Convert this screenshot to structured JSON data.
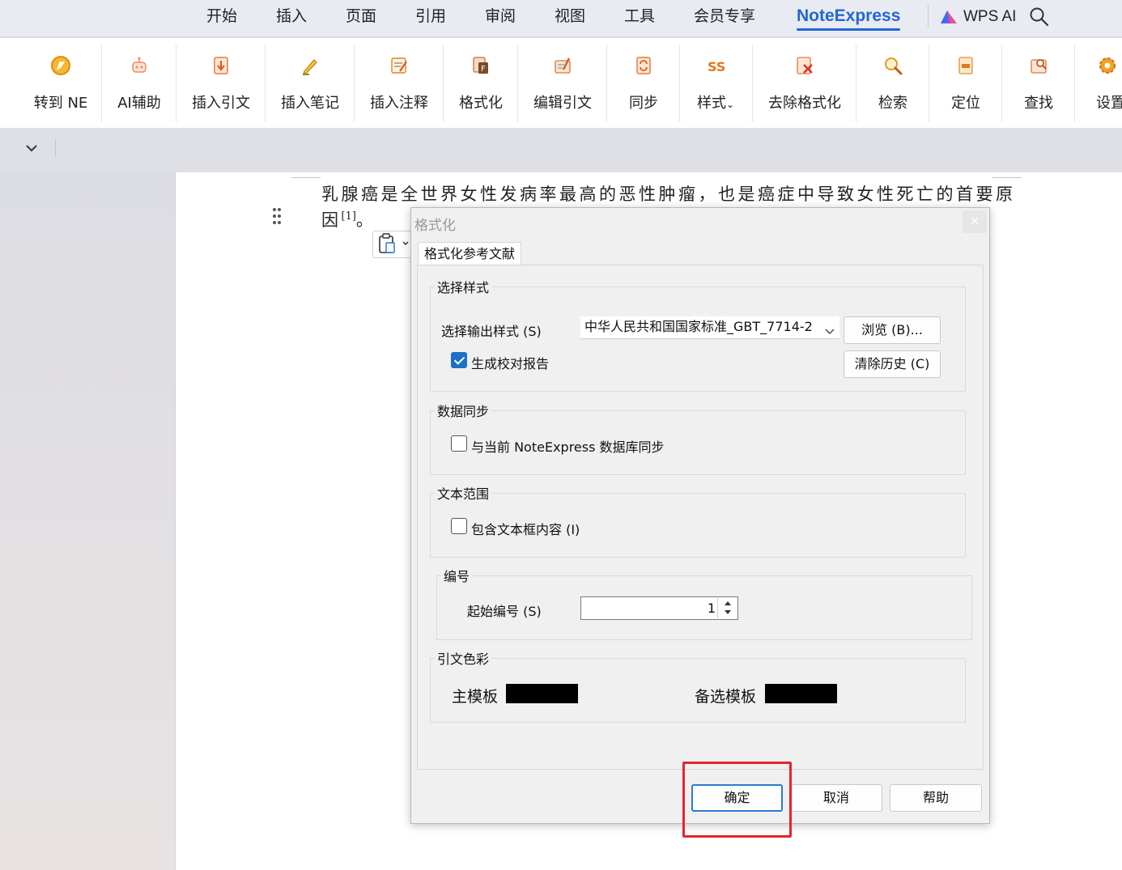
{
  "menu": {
    "items": [
      "开始",
      "插入",
      "页面",
      "引用",
      "审阅",
      "视图",
      "工具",
      "会员专享",
      "NoteExpress"
    ],
    "active_index": 8,
    "wps_ai": "WPS AI"
  },
  "ribbon": {
    "buttons": [
      "转到 NE",
      "AI辅助",
      "插入引文",
      "插入笔记",
      "插入注释",
      "格式化",
      "编辑引文",
      "同步",
      "样式",
      "去除格式化",
      "检索",
      "定位",
      "查找",
      "设置"
    ]
  },
  "document": {
    "line1": "乳腺癌是全世界女性发病率最高的恶性肿瘤，也是癌症中导致女性死亡的首要原",
    "line2": "因",
    "citation": "[1]",
    "line2_end": "。"
  },
  "dialog": {
    "title": "格式化",
    "tab": "格式化参考文献",
    "style_group": {
      "legend": "选择样式",
      "output_label": "选择输出样式 (S)",
      "selected_style": "中华人民共和国国家标准_GBT_7714-2",
      "browse_button": "浏览 (B)...",
      "clear_history_button": "清除历史 (C)",
      "report_checkbox": "生成校对报告",
      "report_checked": true
    },
    "sync_group": {
      "legend": "数据同步",
      "sync_checkbox": "与当前 NoteExpress 数据库同步",
      "sync_checked": false
    },
    "text_group": {
      "legend": "文本范围",
      "textbox_checkbox": "包含文本框内容 (I)",
      "textbox_checked": false
    },
    "number_group": {
      "legend": "编号",
      "start_label": "起始编号 (S)",
      "start_value": "1"
    },
    "color_group": {
      "legend": "引文色彩",
      "main_template": "主模板",
      "alt_template": "备选模板",
      "main_color": "#000000",
      "alt_color": "#000000"
    },
    "buttons": {
      "ok": "确定",
      "cancel": "取消",
      "help": "帮助"
    }
  },
  "colors": {
    "accent": "#2166d6",
    "highlight": "#e3262a"
  }
}
